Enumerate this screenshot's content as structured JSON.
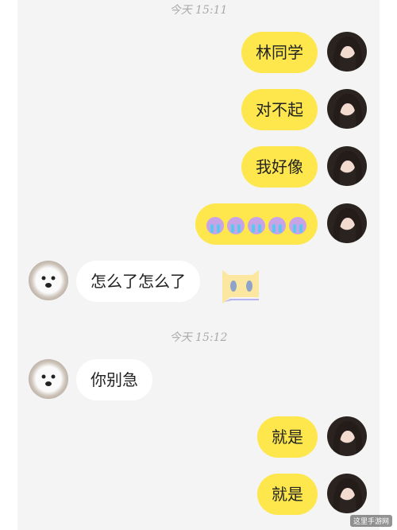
{
  "timestamps": [
    "今天 15:11",
    "今天 15:12"
  ],
  "messages": [
    {
      "side": "me",
      "text": "林同学"
    },
    {
      "side": "me",
      "text": "对不起"
    },
    {
      "side": "me",
      "text": "我好像"
    },
    {
      "side": "me",
      "emoji": "crying-face-icon",
      "count": 5
    },
    {
      "side": "them",
      "text": "怎么了怎么了"
    },
    {
      "side": "them",
      "text": "你别急"
    },
    {
      "side": "me",
      "text": "就是"
    },
    {
      "side": "me",
      "text": "就是"
    }
  ],
  "colors": {
    "my_bubble": "#fde74c",
    "their_bubble": "#ffffff",
    "background": "#f4f4f4",
    "timestamp": "#a9a9a9"
  },
  "watermark": "这里手游网"
}
